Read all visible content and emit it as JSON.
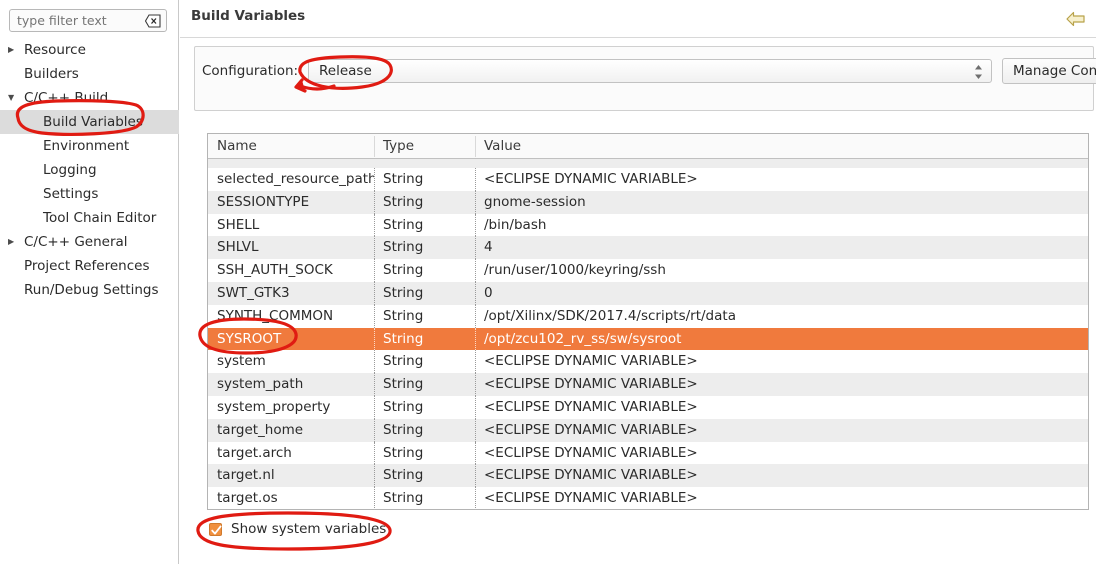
{
  "sidebar": {
    "filter": {
      "placeholder": "type filter text",
      "value": "",
      "clear_icon": "clear-x-icon"
    },
    "items": [
      {
        "label": "Resource",
        "level": 0,
        "arrow": "collapsed",
        "selected": false
      },
      {
        "label": "Builders",
        "level": 0,
        "arrow": "none",
        "selected": false
      },
      {
        "label": "C/C++ Build",
        "level": 0,
        "arrow": "expanded",
        "selected": false
      },
      {
        "label": "Build Variables",
        "level": 1,
        "arrow": "none",
        "selected": true
      },
      {
        "label": "Environment",
        "level": 1,
        "arrow": "none",
        "selected": false
      },
      {
        "label": "Logging",
        "level": 1,
        "arrow": "none",
        "selected": false
      },
      {
        "label": "Settings",
        "level": 1,
        "arrow": "none",
        "selected": false
      },
      {
        "label": "Tool Chain Editor",
        "level": 1,
        "arrow": "none",
        "selected": false
      },
      {
        "label": "C/C++ General",
        "level": 0,
        "arrow": "collapsed",
        "selected": false
      },
      {
        "label": "Project References",
        "level": 0,
        "arrow": "none",
        "selected": false
      },
      {
        "label": "Run/Debug Settings",
        "level": 0,
        "arrow": "none",
        "selected": false
      }
    ]
  },
  "header": {
    "title": "Build Variables",
    "back_icon": "back-arrow-icon"
  },
  "config": {
    "label": "Configuration:",
    "value": "Release",
    "spinner_icon": "spinner-up-down-icon",
    "manage_button": "Manage Conf"
  },
  "table": {
    "columns": [
      "Name",
      "Type",
      "Value"
    ],
    "rows": [
      {
        "name": "",
        "type": "",
        "value": "",
        "clipped": true,
        "selected": false
      },
      {
        "name": "selected_resource_path",
        "type": "String",
        "value": "<ECLIPSE DYNAMIC VARIABLE>",
        "clipped": false,
        "selected": false
      },
      {
        "name": "SESSIONTYPE",
        "type": "String",
        "value": "gnome-session",
        "clipped": false,
        "selected": false
      },
      {
        "name": "SHELL",
        "type": "String",
        "value": "/bin/bash",
        "clipped": false,
        "selected": false
      },
      {
        "name": "SHLVL",
        "type": "String",
        "value": "4",
        "clipped": false,
        "selected": false
      },
      {
        "name": "SSH_AUTH_SOCK",
        "type": "String",
        "value": "/run/user/1000/keyring/ssh",
        "clipped": false,
        "selected": false
      },
      {
        "name": "SWT_GTK3",
        "type": "String",
        "value": "0",
        "clipped": false,
        "selected": false
      },
      {
        "name": "SYNTH_COMMON",
        "type": "String",
        "value": "/opt/Xilinx/SDK/2017.4/scripts/rt/data",
        "clipped": false,
        "selected": false
      },
      {
        "name": "SYSROOT",
        "type": "String",
        "value": "/opt/zcu102_rv_ss/sw/sysroot",
        "clipped": false,
        "selected": true
      },
      {
        "name": "system",
        "type": "String",
        "value": "<ECLIPSE DYNAMIC VARIABLE>",
        "clipped": false,
        "selected": false
      },
      {
        "name": "system_path",
        "type": "String",
        "value": "<ECLIPSE DYNAMIC VARIABLE>",
        "clipped": false,
        "selected": false
      },
      {
        "name": "system_property",
        "type": "String",
        "value": "<ECLIPSE DYNAMIC VARIABLE>",
        "clipped": false,
        "selected": false
      },
      {
        "name": "target_home",
        "type": "String",
        "value": "<ECLIPSE DYNAMIC VARIABLE>",
        "clipped": false,
        "selected": false
      },
      {
        "name": "target.arch",
        "type": "String",
        "value": "<ECLIPSE DYNAMIC VARIABLE>",
        "clipped": false,
        "selected": false
      },
      {
        "name": "target.nl",
        "type": "String",
        "value": "<ECLIPSE DYNAMIC VARIABLE>",
        "clipped": false,
        "selected": false
      },
      {
        "name": "target.os",
        "type": "String",
        "value": "<ECLIPSE DYNAMIC VARIABLE>",
        "clipped": false,
        "selected": false
      }
    ]
  },
  "footer": {
    "show_system_variables": "Show system variables",
    "show_system_variables_checked": true
  },
  "colors": {
    "selection_orange": "#f07a3d",
    "annotation_red": "#e01b12",
    "sidebar_selection": "#dcdcdc",
    "row_alt": "#ededed",
    "back_arrow_yellow": "#f5eec8"
  }
}
